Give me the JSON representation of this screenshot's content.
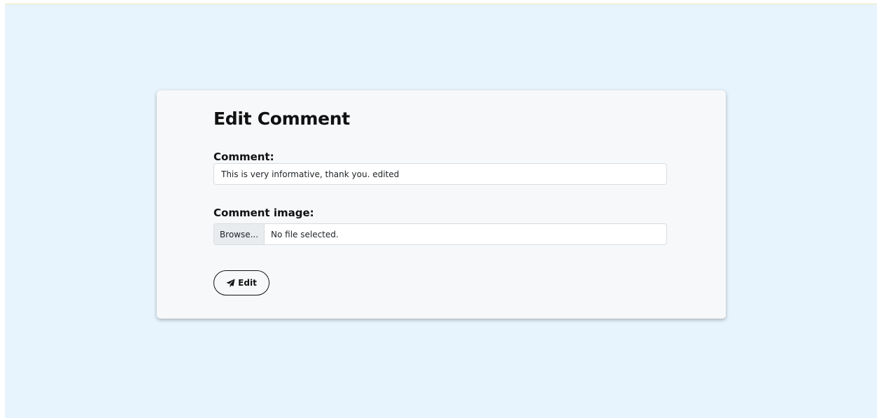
{
  "card": {
    "title": "Edit Comment"
  },
  "comment_field": {
    "label": "Comment:",
    "value": "This is very informative, thank you. edited"
  },
  "image_field": {
    "label": "Comment image:",
    "browse_label": "Browse...",
    "status": "No file selected."
  },
  "submit": {
    "icon": "paper-plane-icon",
    "label": "Edit"
  },
  "colors": {
    "page_background": "#e7f4fd",
    "card_background": "#f7f8fa",
    "text": "#111111"
  }
}
